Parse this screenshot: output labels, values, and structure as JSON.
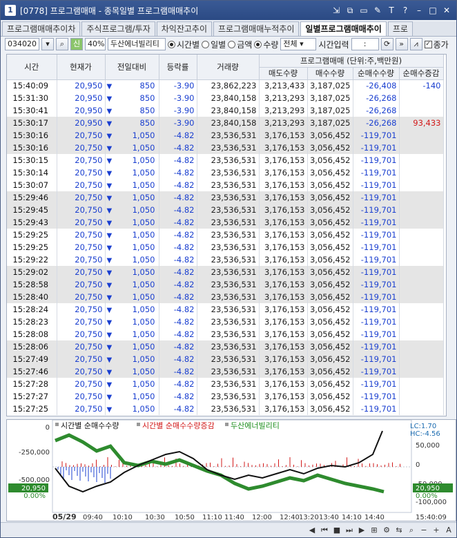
{
  "window": {
    "id": "[0778]",
    "title": "프로그램매매 - 종목일별 프로그램매매추이"
  },
  "tabs": [
    "프로그램매매추이차",
    "주식프로그램/투자",
    "차익잔고추이",
    "프로그램매매누적추이",
    "일별프로그램매매추이",
    "프로"
  ],
  "active_tab": 4,
  "toolbar": {
    "code": "034020",
    "badge": "신",
    "percent": "40%",
    "stock_name": "두산에너빌리티",
    "radio_time": "시간별",
    "radio_day": "일별",
    "radio_amount": "금액",
    "radio_qty": "수량",
    "select_all": "전체",
    "time_input_label": "시간입력",
    "time_value": ":",
    "checkbox_label": "종가"
  },
  "table": {
    "headers": [
      "시간",
      "현재가",
      "전일대비",
      "등락률",
      "거래량"
    ],
    "group_header": "프로그램매매 (단위:주,백만원)",
    "sub_headers": [
      "매도수량",
      "매수수량",
      "순매수수량",
      "순매수증감"
    ],
    "rows": [
      [
        "15:40:09",
        "20,950",
        "850",
        "-3.90",
        "23,862,223",
        "3,213,433",
        "3,187,025",
        "-26,408",
        "-140"
      ],
      [
        "15:31:30",
        "20,950",
        "850",
        "-3.90",
        "23,840,158",
        "3,213,293",
        "3,187,025",
        "-26,268",
        ""
      ],
      [
        "15:30:41",
        "20,950",
        "850",
        "-3.90",
        "23,840,158",
        "3,213,293",
        "3,187,025",
        "-26,268",
        ""
      ],
      [
        "15:30:17",
        "20,950",
        "850",
        "-3.90",
        "23,840,158",
        "3,213,293",
        "3,187,025",
        "-26,268",
        "93,433"
      ],
      [
        "15:30:16",
        "20,750",
        "1,050",
        "-4.82",
        "23,536,531",
        "3,176,153",
        "3,056,452",
        "-119,701",
        ""
      ],
      [
        "15:30:16",
        "20,750",
        "1,050",
        "-4.82",
        "23,536,531",
        "3,176,153",
        "3,056,452",
        "-119,701",
        ""
      ],
      [
        "15:30:15",
        "20,750",
        "1,050",
        "-4.82",
        "23,536,531",
        "3,176,153",
        "3,056,452",
        "-119,701",
        ""
      ],
      [
        "15:30:14",
        "20,750",
        "1,050",
        "-4.82",
        "23,536,531",
        "3,176,153",
        "3,056,452",
        "-119,701",
        ""
      ],
      [
        "15:30:07",
        "20,750",
        "1,050",
        "-4.82",
        "23,536,531",
        "3,176,153",
        "3,056,452",
        "-119,701",
        ""
      ],
      [
        "15:29:46",
        "20,750",
        "1,050",
        "-4.82",
        "23,536,531",
        "3,176,153",
        "3,056,452",
        "-119,701",
        ""
      ],
      [
        "15:29:45",
        "20,750",
        "1,050",
        "-4.82",
        "23,536,531",
        "3,176,153",
        "3,056,452",
        "-119,701",
        ""
      ],
      [
        "15:29:43",
        "20,750",
        "1,050",
        "-4.82",
        "23,536,531",
        "3,176,153",
        "3,056,452",
        "-119,701",
        ""
      ],
      [
        "15:29:25",
        "20,750",
        "1,050",
        "-4.82",
        "23,536,531",
        "3,176,153",
        "3,056,452",
        "-119,701",
        ""
      ],
      [
        "15:29:25",
        "20,750",
        "1,050",
        "-4.82",
        "23,536,531",
        "3,176,153",
        "3,056,452",
        "-119,701",
        ""
      ],
      [
        "15:29:22",
        "20,750",
        "1,050",
        "-4.82",
        "23,536,531",
        "3,176,153",
        "3,056,452",
        "-119,701",
        ""
      ],
      [
        "15:29:02",
        "20,750",
        "1,050",
        "-4.82",
        "23,536,531",
        "3,176,153",
        "3,056,452",
        "-119,701",
        ""
      ],
      [
        "15:28:58",
        "20,750",
        "1,050",
        "-4.82",
        "23,536,531",
        "3,176,153",
        "3,056,452",
        "-119,701",
        ""
      ],
      [
        "15:28:40",
        "20,750",
        "1,050",
        "-4.82",
        "23,536,531",
        "3,176,153",
        "3,056,452",
        "-119,701",
        ""
      ],
      [
        "15:28:24",
        "20,750",
        "1,050",
        "-4.82",
        "23,536,531",
        "3,176,153",
        "3,056,452",
        "-119,701",
        ""
      ],
      [
        "15:28:23",
        "20,750",
        "1,050",
        "-4.82",
        "23,536,531",
        "3,176,153",
        "3,056,452",
        "-119,701",
        ""
      ],
      [
        "15:28:08",
        "20,750",
        "1,050",
        "-4.82",
        "23,536,531",
        "3,176,153",
        "3,056,452",
        "-119,701",
        ""
      ],
      [
        "15:28:06",
        "20,750",
        "1,050",
        "-4.82",
        "23,536,531",
        "3,176,153",
        "3,056,452",
        "-119,701",
        ""
      ],
      [
        "15:27:49",
        "20,750",
        "1,050",
        "-4.82",
        "23,536,531",
        "3,176,153",
        "3,056,452",
        "-119,701",
        ""
      ],
      [
        "15:27:46",
        "20,750",
        "1,050",
        "-4.82",
        "23,536,531",
        "3,176,153",
        "3,056,452",
        "-119,701",
        ""
      ],
      [
        "15:27:28",
        "20,750",
        "1,050",
        "-4.82",
        "23,536,531",
        "3,176,153",
        "3,056,452",
        "-119,701",
        ""
      ],
      [
        "15:27:27",
        "20,750",
        "1,050",
        "-4.82",
        "23,536,531",
        "3,176,153",
        "3,056,452",
        "-119,701",
        ""
      ],
      [
        "15:27:25",
        "20,750",
        "1,050",
        "-4.82",
        "23,536,531",
        "3,176,153",
        "3,056,452",
        "-119,701",
        ""
      ]
    ],
    "gray_rows": [
      3,
      4,
      5,
      9,
      10,
      11,
      15,
      16,
      17,
      21,
      22,
      23
    ]
  },
  "chart": {
    "legend": [
      "시간별 순매수수량",
      "시간별 순매수수량증감",
      "두산에너빌리티"
    ],
    "legend_colors": [
      "#111111",
      "#d21919",
      "#1a8c1a"
    ],
    "y_left": [
      "0",
      "-250,000",
      "-500,000"
    ],
    "y_right": [
      "50,000",
      "0",
      "-50,000",
      "-100,000"
    ],
    "lc": "LC:1.70",
    "hc": "HC:-4.56",
    "left_price": "20,950",
    "left_pct": "0.00%",
    "right_price": "20,950",
    "right_pct": "0.00%",
    "date": "05/29",
    "x_ticks": [
      "09:40",
      "10:10",
      "10:30",
      "10:50",
      "11:10",
      "11:40",
      "12:00",
      "12:40",
      "13:20",
      "13:40",
      "14:10",
      "14:40"
    ],
    "end_time": "15:40:09"
  }
}
